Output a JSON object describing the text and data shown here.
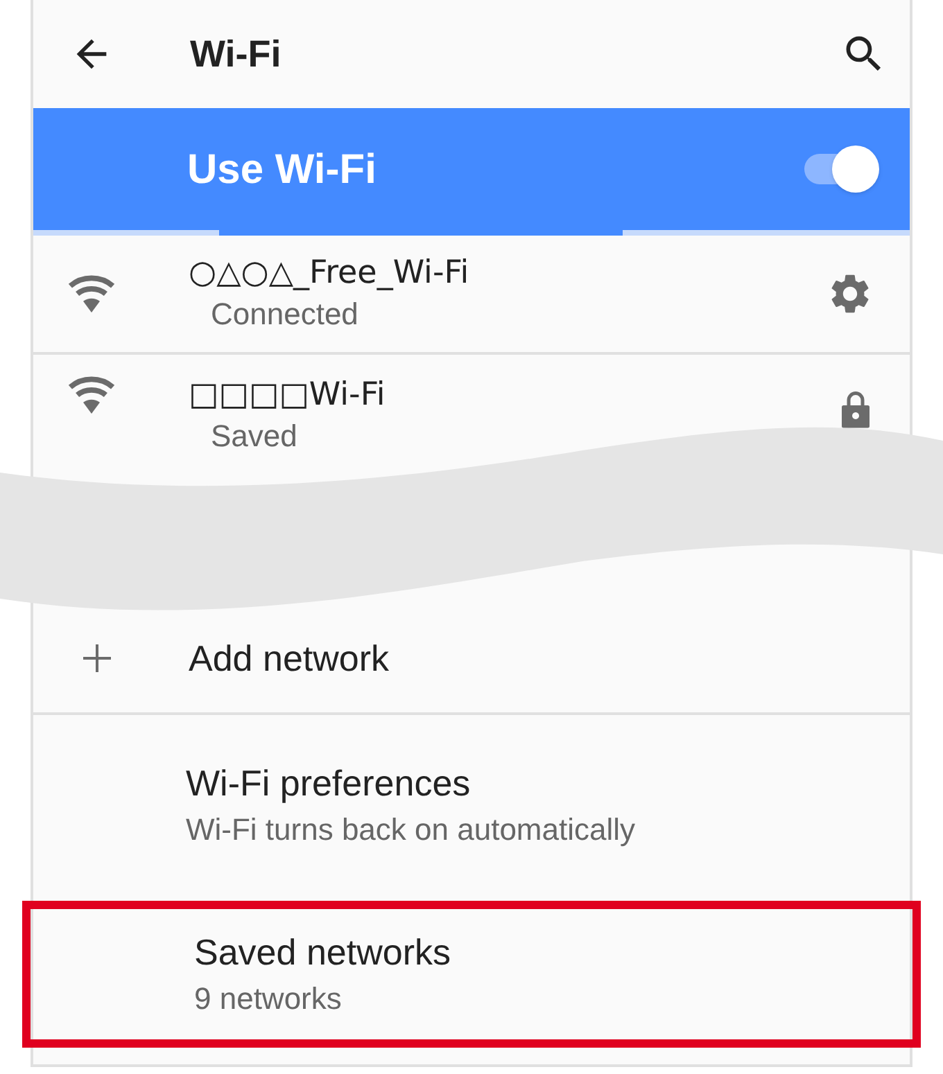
{
  "app_bar": {
    "title": "Wi-Fi"
  },
  "master_switch": {
    "label": "Use Wi-Fi",
    "on": true
  },
  "scan_progress": {
    "level": 0.46
  },
  "networks": [
    {
      "name": "○△○△_Free_Wi-Fi",
      "status": "Connected",
      "kind": "connected"
    },
    {
      "name": "□□□□Wi-Fi",
      "status": "Saved",
      "kind": "saved"
    }
  ],
  "add_network": {
    "label": "Add network"
  },
  "preferences": [
    {
      "title": "Wi-Fi preferences",
      "summary": "Wi-Fi turns back on automatically",
      "highlighted": false
    },
    {
      "title": "Saved networks",
      "summary": "9 networks",
      "highlighted": true
    }
  ]
}
